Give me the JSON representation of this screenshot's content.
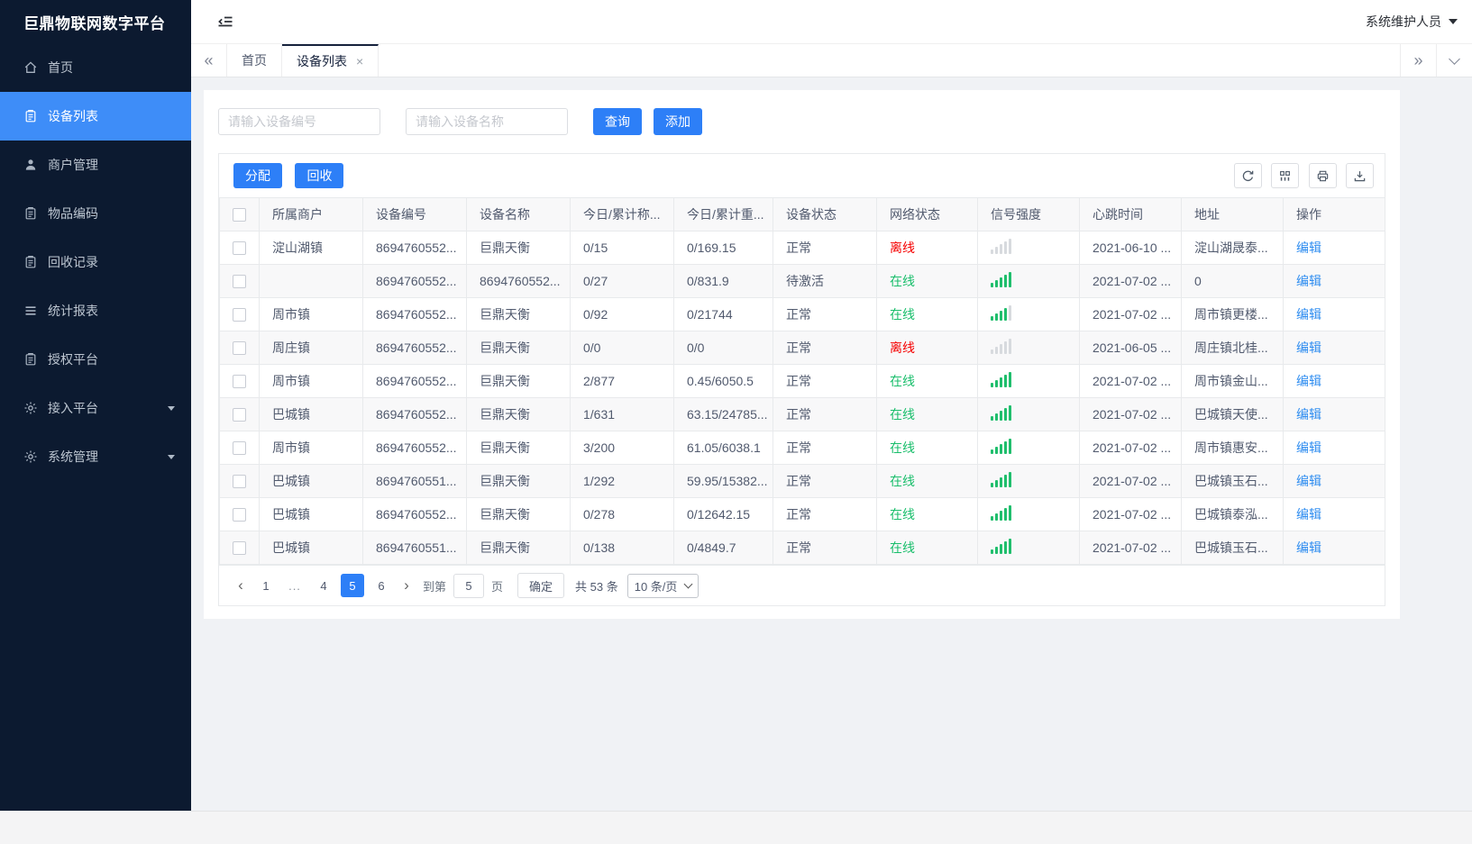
{
  "app": {
    "title": "巨鼎物联网数字平台",
    "user_menu": "系统维护人员"
  },
  "sidebar": {
    "items": [
      {
        "label": "首页",
        "icon": "home",
        "active": false
      },
      {
        "label": "设备列表",
        "icon": "clipboard",
        "active": true
      },
      {
        "label": "商户管理",
        "icon": "user",
        "active": false
      },
      {
        "label": "物品编码",
        "icon": "clipboard",
        "active": false
      },
      {
        "label": "回收记录",
        "icon": "clipboard",
        "active": false
      },
      {
        "label": "统计报表",
        "icon": "list",
        "active": false
      },
      {
        "label": "授权平台",
        "icon": "clipboard",
        "active": false
      },
      {
        "label": "接入平台",
        "icon": "gear",
        "active": false,
        "expandable": true
      },
      {
        "label": "系统管理",
        "icon": "gear",
        "active": false,
        "expandable": true
      }
    ]
  },
  "tabbar": {
    "tabs": [
      {
        "label": "首页",
        "active": false,
        "closable": false
      },
      {
        "label": "设备列表",
        "active": true,
        "closable": true
      }
    ]
  },
  "search": {
    "device_no_placeholder": "请输入设备编号",
    "device_name_placeholder": "请输入设备名称",
    "query_label": "查询",
    "add_label": "添加"
  },
  "toolbar": {
    "assign_label": "分配",
    "recycle_label": "回收",
    "icons": [
      "refresh",
      "columns",
      "printer",
      "download"
    ]
  },
  "table": {
    "columns": [
      "所属商户",
      "设备编号",
      "设备名称",
      "今日/累计称...",
      "今日/累计重...",
      "设备状态",
      "网络状态",
      "信号强度",
      "心跳时间",
      "地址",
      "操作"
    ],
    "edit_label": "编辑",
    "rows": [
      {
        "merchant": "淀山湖镇",
        "device_no": "8694760552...",
        "device_name": "巨鼎天衡",
        "count": "0/15",
        "weight": "0/169.15",
        "status": "正常",
        "network": "离线",
        "online": false,
        "signal_bars": 0,
        "heartbeat": "2021-06-10 ...",
        "address": "淀山湖晟泰..."
      },
      {
        "merchant": "",
        "device_no": "8694760552...",
        "device_name": "8694760552...",
        "count": "0/27",
        "weight": "0/831.9",
        "status": "待激活",
        "network": "在线",
        "online": true,
        "signal_bars": 5,
        "heartbeat": "2021-07-02 ...",
        "address": "0"
      },
      {
        "merchant": "周市镇",
        "device_no": "8694760552...",
        "device_name": "巨鼎天衡",
        "count": "0/92",
        "weight": "0/21744",
        "status": "正常",
        "network": "在线",
        "online": true,
        "signal_bars": 4,
        "heartbeat": "2021-07-02 ...",
        "address": "周市镇更楼..."
      },
      {
        "merchant": "周庄镇",
        "device_no": "8694760552...",
        "device_name": "巨鼎天衡",
        "count": "0/0",
        "weight": "0/0",
        "status": "正常",
        "network": "离线",
        "online": false,
        "signal_bars": 0,
        "heartbeat": "2021-06-05 ...",
        "address": "周庄镇北桂..."
      },
      {
        "merchant": "周市镇",
        "device_no": "8694760552...",
        "device_name": "巨鼎天衡",
        "count": "2/877",
        "weight": "0.45/6050.5",
        "status": "正常",
        "network": "在线",
        "online": true,
        "signal_bars": 5,
        "heartbeat": "2021-07-02 ...",
        "address": "周市镇金山..."
      },
      {
        "merchant": "巴城镇",
        "device_no": "8694760552...",
        "device_name": "巨鼎天衡",
        "count": "1/631",
        "weight": "63.15/24785...",
        "status": "正常",
        "network": "在线",
        "online": true,
        "signal_bars": 5,
        "heartbeat": "2021-07-02 ...",
        "address": "巴城镇天使..."
      },
      {
        "merchant": "周市镇",
        "device_no": "8694760552...",
        "device_name": "巨鼎天衡",
        "count": "3/200",
        "weight": "61.05/6038.1",
        "status": "正常",
        "network": "在线",
        "online": true,
        "signal_bars": 5,
        "heartbeat": "2021-07-02 ...",
        "address": "周市镇惠安..."
      },
      {
        "merchant": "巴城镇",
        "device_no": "8694760551...",
        "device_name": "巨鼎天衡",
        "count": "1/292",
        "weight": "59.95/15382...",
        "status": "正常",
        "network": "在线",
        "online": true,
        "signal_bars": 5,
        "heartbeat": "2021-07-02 ...",
        "address": "巴城镇玉石..."
      },
      {
        "merchant": "巴城镇",
        "device_no": "8694760552...",
        "device_name": "巨鼎天衡",
        "count": "0/278",
        "weight": "0/12642.15",
        "status": "正常",
        "network": "在线",
        "online": true,
        "signal_bars": 5,
        "heartbeat": "2021-07-02 ...",
        "address": "巴城镇泰泓..."
      },
      {
        "merchant": "巴城镇",
        "device_no": "8694760551...",
        "device_name": "巨鼎天衡",
        "count": "0/138",
        "weight": "0/4849.7",
        "status": "正常",
        "network": "在线",
        "online": true,
        "signal_bars": 5,
        "heartbeat": "2021-07-02 ...",
        "address": "巴城镇玉石..."
      }
    ]
  },
  "pagination": {
    "pages": [
      "1",
      "...",
      "4",
      "5",
      "6"
    ],
    "active": "5",
    "goto_label": "到第",
    "goto_value": "5",
    "page_unit_label": "页",
    "confirm_label": "确定",
    "total_label": "共 53 条",
    "page_size_label": "10 条/页"
  },
  "colors": {
    "primary": "#2d7ff7",
    "sidebar_bg": "#0c1a30",
    "sidebar_active": "#3e8df8",
    "online_green": "#19be6b",
    "offline_red": "#f50000",
    "link_blue": "#2d8cf0"
  }
}
